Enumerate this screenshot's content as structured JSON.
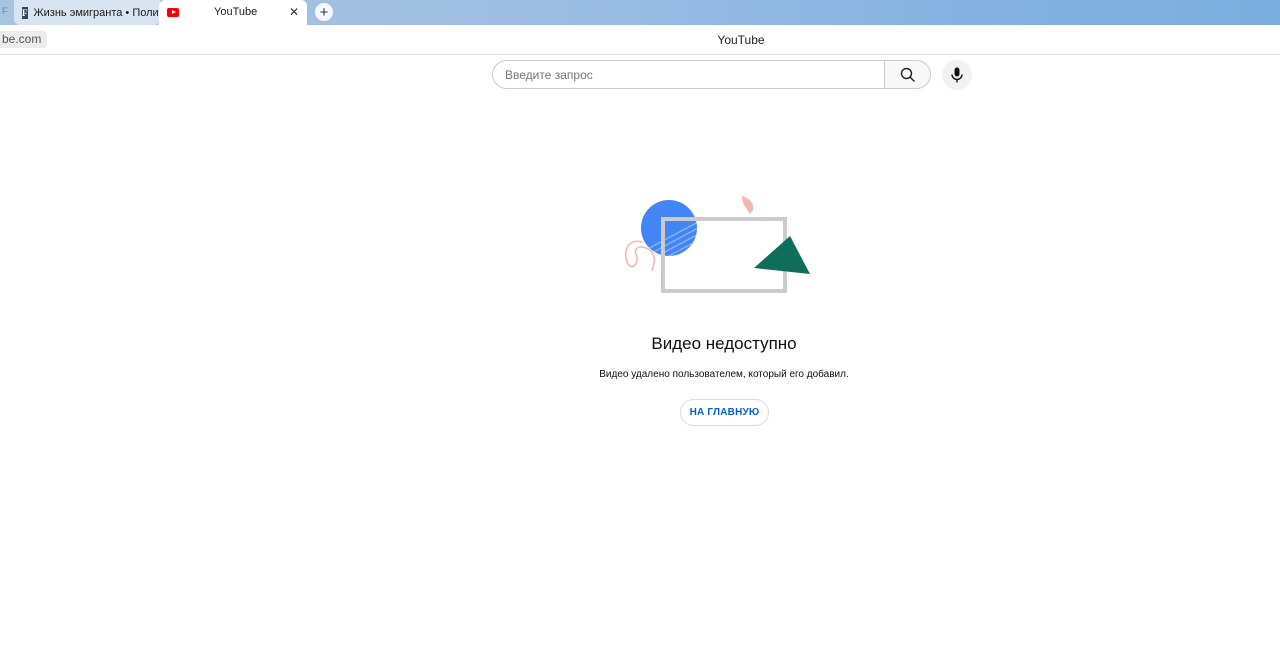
{
  "tabs": [
    {
      "title": "Жизнь эмигранта • Полит"
    },
    {
      "title": "YouTube"
    }
  ],
  "tab_cut_text": "F",
  "address": {
    "url_text": "be.com",
    "page_title": "YouTube"
  },
  "search": {
    "placeholder": "Введите запрос"
  },
  "error": {
    "title": "Видео недоступно",
    "subtitle": "Видео удалено пользователем, который его добавил.",
    "home_button": "НА ГЛАВНУЮ"
  },
  "colors": {
    "accent": "#065fd4",
    "youtube_red": "#ff0000"
  }
}
